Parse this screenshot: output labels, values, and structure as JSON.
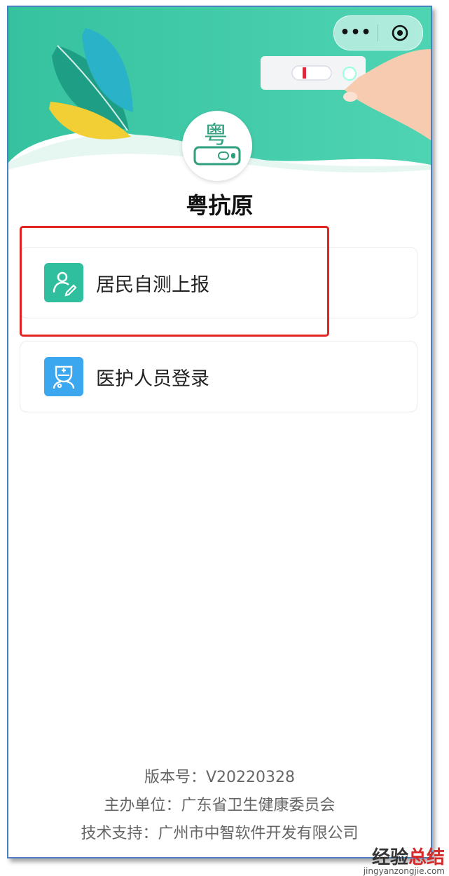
{
  "capsule": {
    "more_label": "•••"
  },
  "app": {
    "title": "粤抗原"
  },
  "menu": [
    {
      "label": "居民自测上报",
      "icon": "resident-icon",
      "color": "#2fbf9f"
    },
    {
      "label": "医护人员登录",
      "icon": "medical-staff-icon",
      "color": "#3aa7ef"
    }
  ],
  "footer": {
    "version": "版本号：V20220328",
    "sponsor": "主办单位：广东省卫生健康委员会",
    "support": "技术支持：广州市中智软件开发有限公司"
  },
  "watermark": {
    "text_black": "经验",
    "text_red": "总结",
    "url": "jingyanzongjie.com"
  },
  "colors": {
    "accent_green": "#2fbf9f",
    "accent_blue": "#3aa7ef",
    "highlight_red": "#e02222",
    "frame_blue": "#4a7fc1"
  }
}
